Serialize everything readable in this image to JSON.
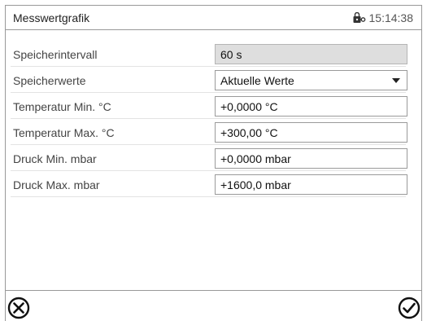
{
  "header": {
    "title": "Messwertgrafik",
    "time": "15:14:38",
    "lock_icon": "lock-key-icon"
  },
  "rows": [
    {
      "label": "Speicherintervall",
      "value": "60 s",
      "type": "readonly"
    },
    {
      "label": "Speicherwerte",
      "value": "Aktuelle Werte",
      "type": "dropdown"
    },
    {
      "label": "Temperatur Min. °C",
      "value": "+0,0000 °C",
      "type": "input"
    },
    {
      "label": "Temperatur Max. °C",
      "value": "+300,00 °C",
      "type": "input"
    },
    {
      "label": "Druck Min. mbar",
      "value": "+0,0000 mbar",
      "type": "input"
    },
    {
      "label": "Druck Max. mbar",
      "value": "+1600,0 mbar",
      "type": "input"
    }
  ],
  "footer": {
    "cancel_icon": "cancel-icon",
    "confirm_icon": "confirm-icon"
  }
}
